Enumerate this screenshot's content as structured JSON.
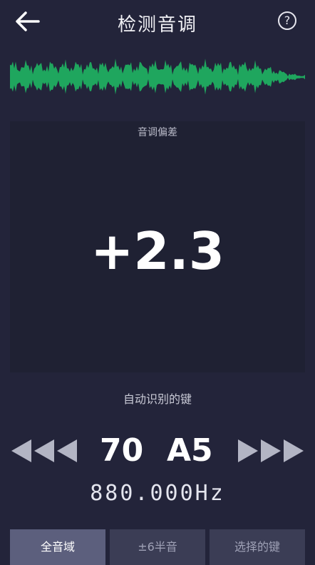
{
  "header": {
    "title": "检测音调",
    "help_label": "?"
  },
  "panel": {
    "label": "音调偏差",
    "deviation": "+2.3"
  },
  "key": {
    "auto_label": "自动识别的键",
    "number": "70",
    "name": "A5",
    "frequency": "880.000Hz"
  },
  "tabs": [
    {
      "label": "全音域",
      "active": true
    },
    {
      "label": "±6半音",
      "active": false
    },
    {
      "label": "选择的键",
      "active": false
    }
  ],
  "colors": {
    "background": "#23243a",
    "panel": "#1f2133",
    "waveform": "#1fa65e",
    "arrow": "#b3b5c4",
    "tab_active": "#5c5f7d",
    "tab_inactive": "#3b3d55"
  }
}
